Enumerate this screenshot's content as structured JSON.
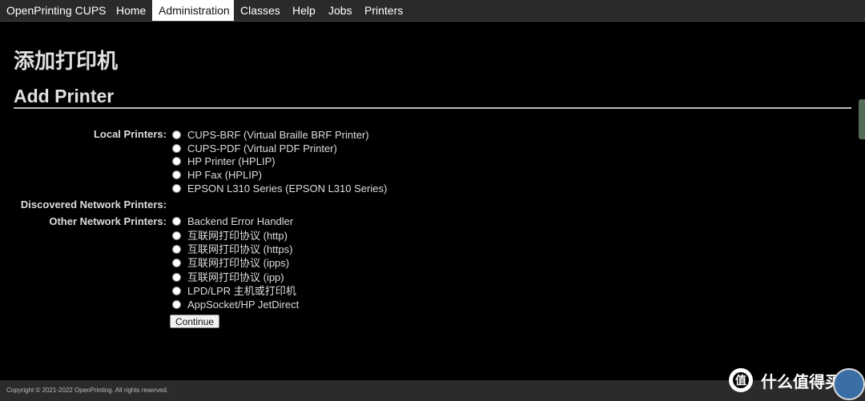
{
  "nav": {
    "tabs": [
      {
        "label": "OpenPrinting CUPS"
      },
      {
        "label": "Home"
      },
      {
        "label": "Administration"
      },
      {
        "label": "Classes"
      },
      {
        "label": "Help"
      },
      {
        "label": "Jobs"
      },
      {
        "label": "Printers"
      }
    ],
    "active": "Administration"
  },
  "page": {
    "title_zh": "添加打印机",
    "title_en": "Add Printer"
  },
  "local_printers": {
    "label": "Local Printers:",
    "options": [
      "CUPS-BRF (Virtual Braille BRF Printer)",
      "CUPS-PDF (Virtual PDF Printer)",
      "HP Printer (HPLIP)",
      "HP Fax (HPLIP)",
      "EPSON L310 Series (EPSON L310 Series)"
    ]
  },
  "discovered_network_printers": {
    "label": "Discovered Network Printers:"
  },
  "other_network_printers": {
    "label": "Other Network Printers:",
    "options": [
      "Backend Error Handler",
      "互联网打印协议 (http)",
      "互联网打印协议 (https)",
      "互联网打印协议 (ipps)",
      "互联网打印协议 (ipp)",
      "LPD/LPR 主机或打印机",
      "AppSocket/HP JetDirect"
    ]
  },
  "continue_label": "Continue",
  "footer": {
    "copyright": "Copyright © 2021-2022 OpenPrinting. All rights reserved."
  },
  "watermark": {
    "logo_glyph": "值",
    "text": "什么值得买"
  }
}
